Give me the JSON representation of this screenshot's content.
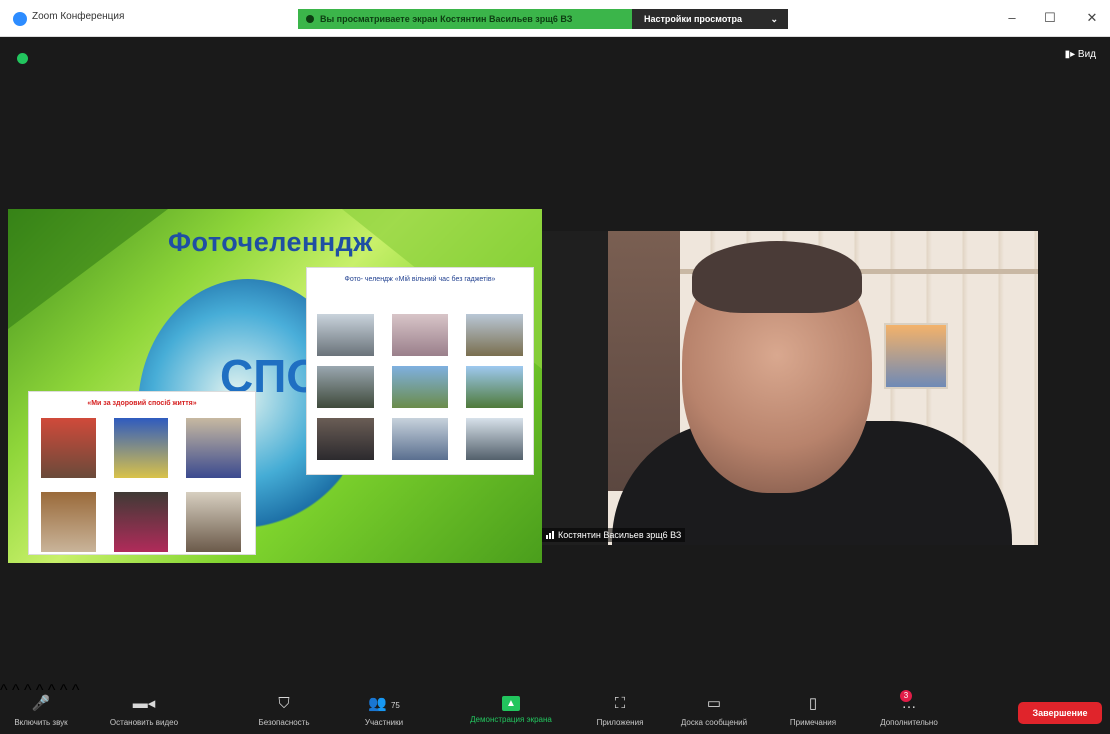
{
  "titlebar": {
    "app_title": "Zoom Конференция",
    "banner_text": "Вы просматриваете экран Костянтин Васильев зрщ6 ВЗ",
    "view_options": "Настройки просмотра",
    "min_icon": "minimize-icon",
    "max_icon": "maximize-icon",
    "close_icon": "close-icon"
  },
  "stage": {
    "view_toggle": "Вид"
  },
  "shared_slide": {
    "title": "Фоточеленндж",
    "sport_word": "СПОР",
    "card_top_caption": "Фото- челендж «Мій вільний час без гаджетів»",
    "card_bottom_caption": "«Ми за здоровий спосіб життя»"
  },
  "participant": {
    "name": "Костянтин Васильев зрщ6 ВЗ"
  },
  "toolbar": {
    "items": [
      {
        "label": "Включить звук",
        "icon": "microphone-muted-icon"
      },
      {
        "label": "Остановить видео",
        "icon": "video-camera-icon"
      },
      {
        "label": "Безопасность",
        "icon": "shield-icon"
      },
      {
        "label": "Участники",
        "icon": "participants-icon",
        "count": "75"
      },
      {
        "label": "Демонстрация экрана",
        "icon": "share-screen-icon"
      },
      {
        "label": "Приложения",
        "icon": "apps-icon"
      },
      {
        "label": "Доска сообщений",
        "icon": "whiteboard-icon"
      },
      {
        "label": "Примечания",
        "icon": "notes-icon"
      },
      {
        "label": "Дополнительно",
        "icon": "more-icon",
        "badge": "3"
      }
    ],
    "end_label": "Завершение"
  },
  "colors": {
    "accent_green": "#22c55e",
    "end_red": "#e0242b",
    "zoom_blue": "#2d8cff"
  }
}
